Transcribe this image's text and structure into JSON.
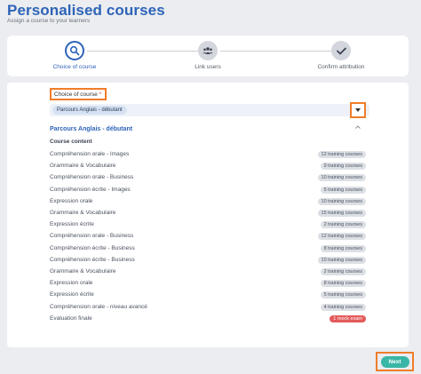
{
  "header": {
    "title": "Personalised courses",
    "subtitle": "Assign a course to your learners"
  },
  "stepper": {
    "steps": [
      {
        "label": "Choice of course",
        "icon": "search-icon",
        "state": "active"
      },
      {
        "label": "Link users",
        "icon": "users-icon",
        "state": "inactive"
      },
      {
        "label": "Confirm attribution",
        "icon": "check-icon",
        "state": "inactive"
      }
    ]
  },
  "form": {
    "field_label": "Choice of course",
    "required_mark": "*",
    "selected_chip": "Parcours Anglais - débutant",
    "dropdown_icon": "caret-down-icon"
  },
  "course": {
    "name": "Parcours Anglais - débutant",
    "content_heading": "Course content",
    "items": [
      {
        "label": "Compréhension orale - Images",
        "badge": "12 training courses",
        "type": "course"
      },
      {
        "label": "Grammaire & Vocabulaire",
        "badge": "9 training courses",
        "type": "course"
      },
      {
        "label": "Compréhension orale - Business",
        "badge": "10 training courses",
        "type": "course"
      },
      {
        "label": "Compréhension écrite - Images",
        "badge": "5 training courses",
        "type": "course"
      },
      {
        "label": "Expression orale",
        "badge": "10 training courses",
        "type": "course"
      },
      {
        "label": "Grammaire & Vocabulaire",
        "badge": "15 training courses",
        "type": "course"
      },
      {
        "label": "Expression écrite",
        "badge": "2 training courses",
        "type": "course"
      },
      {
        "label": "Compréhension orale - Business",
        "badge": "12 training courses",
        "type": "course"
      },
      {
        "label": "Compréhension écrite - Business",
        "badge": "8 training courses",
        "type": "course"
      },
      {
        "label": "Compréhension écrite - Business",
        "badge": "10 training courses",
        "type": "course"
      },
      {
        "label": "Grammaire & Vocabulaire",
        "badge": "2 training courses",
        "type": "course"
      },
      {
        "label": "Expression orale",
        "badge": "8 training courses",
        "type": "course"
      },
      {
        "label": "Expression écrite",
        "badge": "5 training courses",
        "type": "course"
      },
      {
        "label": "Compréhension orale - niveau avancé",
        "badge": "4 training courses",
        "type": "course"
      },
      {
        "label": "Evaluation finale",
        "badge": "1 mock exam",
        "type": "exam"
      }
    ]
  },
  "footer": {
    "next_label": "Next"
  },
  "colors": {
    "primary": "#2e63b8",
    "highlight": "#f07d2b",
    "next_button": "#39b6a6",
    "exam_badge": "#e45a5a"
  }
}
